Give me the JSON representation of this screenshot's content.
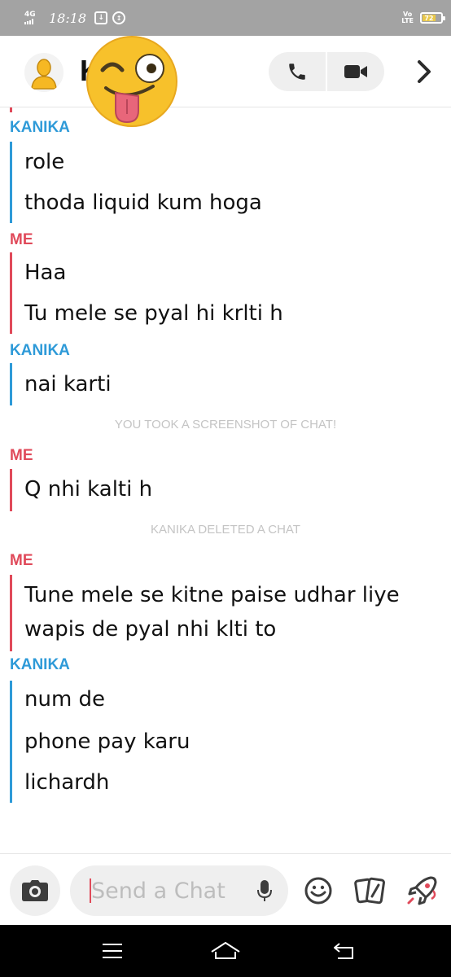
{
  "status_bar": {
    "network": "4G",
    "time": "18:18",
    "volte": "VoLTE",
    "battery_level": "72",
    "icons": [
      "download-icon",
      "data-saver-icon",
      "volte-icon",
      "battery-icon"
    ]
  },
  "header": {
    "contact_initial": "K",
    "icons": [
      "avatar-icon",
      "winking-tongue-emoji",
      "phone-icon",
      "video-icon",
      "chevron-right-icon"
    ]
  },
  "chat": {
    "sender_kanika": "KANIKA",
    "sender_me": "ME",
    "colors": {
      "kanika": "#2e9ad8",
      "me": "#e04a5a",
      "system": "#c4c4c4"
    },
    "groups": [
      {
        "sender": "KANIKA",
        "messages": [
          "role",
          "thoda liquid kum hoga"
        ]
      },
      {
        "sender": "ME",
        "messages": [
          "Haa",
          "Tu mele se pyal hi krlti h"
        ]
      },
      {
        "sender": "KANIKA",
        "messages": [
          "nai karti"
        ]
      },
      {
        "system": "YOU TOOK A SCREENSHOT OF CHAT!"
      },
      {
        "sender": "ME",
        "messages": [
          "Q nhi kalti h"
        ]
      },
      {
        "system": "KANIKA DELETED A CHAT"
      },
      {
        "sender": "ME",
        "messages": [
          "Tune mele se kitne paise udhar liye",
          "wapis de pyal nhi klti to"
        ]
      },
      {
        "sender": "KANIKA",
        "messages": [
          "num de",
          "phone pay karu",
          "lichardh"
        ]
      }
    ]
  },
  "composer": {
    "placeholder": "Send a Chat",
    "icons": [
      "camera-icon",
      "mic-icon",
      "smiley-icon",
      "sticker-cards-icon",
      "rocket-icon"
    ]
  },
  "navbar": {
    "icons": [
      "menu-icon",
      "home-icon",
      "back-icon"
    ]
  }
}
